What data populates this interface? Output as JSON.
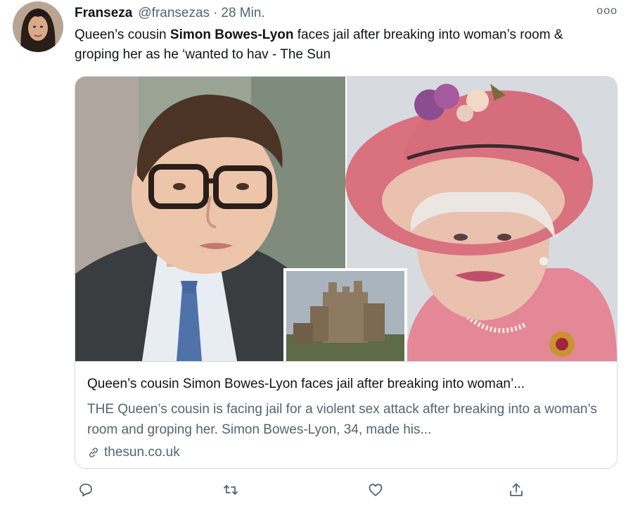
{
  "tweet": {
    "display_name": "Franseza",
    "handle": "@fransezas",
    "separator": "·",
    "time": "28 Min.",
    "more_label": "ooo",
    "text_before": "Queen’s cousin ",
    "text_bold": "Simon Bowes-Lyon",
    "text_after": " faces jail after breaking into woman’s room & groping her as he ‘wanted to hav - The Sun"
  },
  "card": {
    "title": "Queen’s cousin Simon Bowes-Lyon faces jail after breaking into woman’...",
    "description": "THE Queen’s cousin is facing jail for a violent sex attack after breaking into a woman’s room and groping her. Simon Bowes-Lyon, 34, made his...",
    "domain": "thesun.co.uk"
  },
  "actions": {
    "icons": [
      "reply-icon",
      "retweet-icon",
      "like-icon",
      "share-icon"
    ]
  },
  "colors": {
    "text_primary": "#0f1419",
    "text_secondary": "#536471",
    "border": "#cfd9de",
    "hat_pink": "#d9717f",
    "coat_pink": "#e48797"
  }
}
